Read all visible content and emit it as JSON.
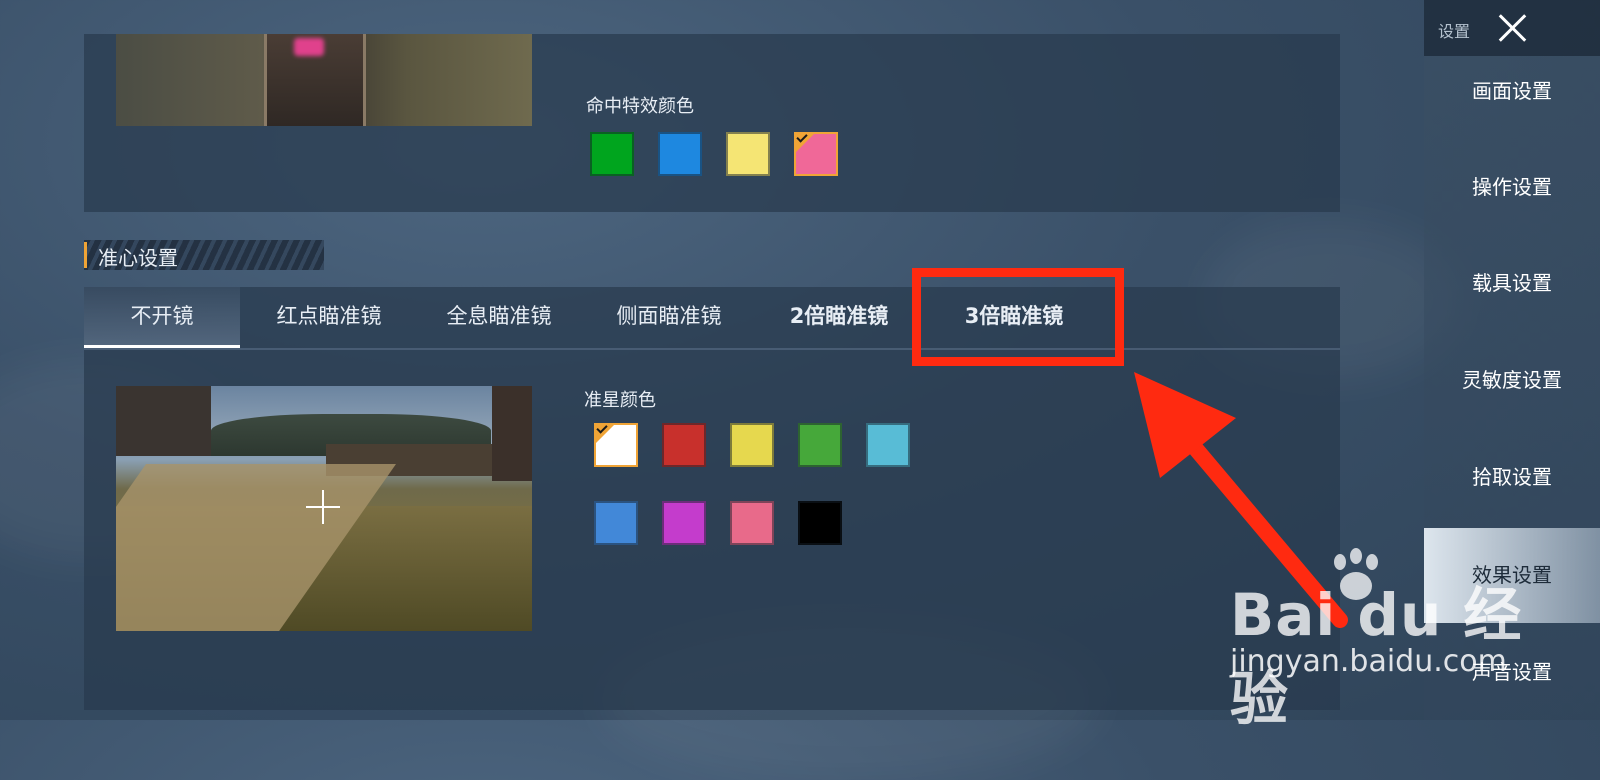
{
  "sidebar": {
    "title": "设置",
    "items": [
      {
        "label": "画面设置"
      },
      {
        "label": "操作设置"
      },
      {
        "label": "载具设置"
      },
      {
        "label": "灵敏度设置"
      },
      {
        "label": "拾取设置"
      },
      {
        "label": "效果设置",
        "active": true
      },
      {
        "label": "声音设置"
      }
    ]
  },
  "hit_effect": {
    "label": "命中特效颜色",
    "colors": [
      "#00a51e",
      "#1e88e0",
      "#f5e574",
      "#f06898"
    ],
    "selected_index": 3
  },
  "crosshair_section": {
    "title": "准心设置",
    "tabs": [
      {
        "label": "不开镜",
        "active": true
      },
      {
        "label": "红点瞄准镜"
      },
      {
        "label": "全息瞄准镜"
      },
      {
        "label": "侧面瞄准镜"
      },
      {
        "label": "2倍瞄准镜"
      },
      {
        "label": "3倍瞄准镜",
        "highlighted": true
      }
    ],
    "color_label": "准星颜色",
    "colors_row1": [
      "#ffffff",
      "#c8302c",
      "#e6d84e",
      "#46a83a",
      "#58bcd6"
    ],
    "colors_row2": [
      "#4288d8",
      "#c43ccc",
      "#e86a8a",
      "#000000"
    ],
    "selected_index": 0
  },
  "annotation_color": "#ff2a10",
  "watermark": {
    "logo_text": "Bai  du 经验",
    "url": "jingyan.baidu.com"
  }
}
